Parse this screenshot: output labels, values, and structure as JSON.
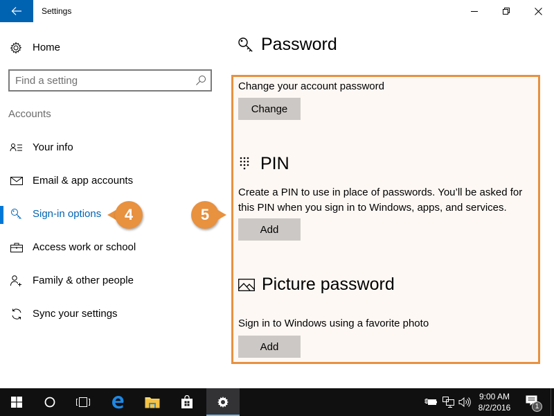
{
  "window": {
    "title": "Settings",
    "back_icon": "arrow-left-icon",
    "controls": {
      "minimize": "minimize-icon",
      "maximize": "restore-icon",
      "close": "close-icon"
    }
  },
  "sidebar": {
    "home_label": "Home",
    "search_placeholder": "Find a setting",
    "search_value": "",
    "section_label": "Accounts",
    "items": [
      {
        "label": "Your info",
        "icon": "contact-card-icon",
        "active": false
      },
      {
        "label": "Email & app accounts",
        "icon": "envelope-icon",
        "active": false
      },
      {
        "label": "Sign-in options",
        "icon": "key-icon",
        "active": true
      },
      {
        "label": "Access work or school",
        "icon": "briefcase-icon",
        "active": false
      },
      {
        "label": "Family & other people",
        "icon": "add-person-icon",
        "active": false
      },
      {
        "label": "Sync your settings",
        "icon": "sync-icon",
        "active": false
      }
    ]
  },
  "callouts": [
    {
      "number": "4",
      "target": "Sign-in options"
    },
    {
      "number": "5",
      "target": "Password, PIN, Picture password section"
    }
  ],
  "main": {
    "title": "Password",
    "password": {
      "description": "Change your account password",
      "button_label": "Change"
    },
    "pin": {
      "title": "PIN",
      "description": "Create a PIN to use in place of passwords. You’ll be asked for this PIN when you sign in to Windows, apps, and services.",
      "button_label": "Add"
    },
    "picture_password": {
      "title": "Picture password",
      "description": "Sign in to Windows using a favorite photo",
      "button_label": "Add"
    }
  },
  "taskbar": {
    "items": [
      {
        "name": "start",
        "icon": "windows-logo-icon",
        "active": false
      },
      {
        "name": "cortana",
        "icon": "cortana-circle-icon",
        "active": false
      },
      {
        "name": "task-view",
        "icon": "task-view-icon",
        "active": false
      },
      {
        "name": "edge",
        "icon": "edge-browser-icon",
        "active": false
      },
      {
        "name": "file-explorer",
        "icon": "folder-icon",
        "active": false
      },
      {
        "name": "store",
        "icon": "store-bag-icon",
        "active": false
      },
      {
        "name": "settings",
        "icon": "gear-icon",
        "active": true
      }
    ],
    "tray": {
      "icons": [
        "battery-plug-icon",
        "network-icon",
        "volume-icon"
      ],
      "time": "9:00 AM",
      "date": "8/2/2016",
      "notification_count": "1"
    }
  },
  "colors": {
    "accent": "#0078d7",
    "titlebar_back": "#0063b1",
    "callout": "#e8913f",
    "highlight_bg": "#fdf8f4",
    "button_bg": "#ccc8c5",
    "taskbar": "#101010"
  }
}
